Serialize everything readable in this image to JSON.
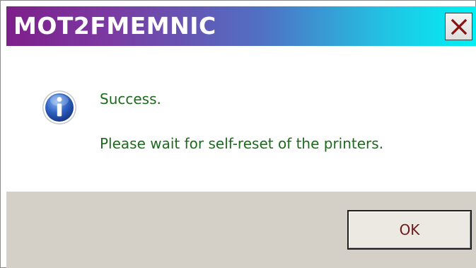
{
  "window": {
    "title": "MOT2FMEMNIC",
    "close_icon": "close-icon"
  },
  "message": {
    "icon": "info-icon",
    "line1": "Success.",
    "line2": "Please wait for self-reset of the printers."
  },
  "buttons": {
    "ok_label": "OK"
  },
  "colors": {
    "title_gradient_start": "#7e1f8a",
    "title_gradient_end": "#00f0f4",
    "message_text": "#1c6a1c",
    "footer_bg": "#d4d0c8",
    "ok_text": "#6b1a1a"
  }
}
